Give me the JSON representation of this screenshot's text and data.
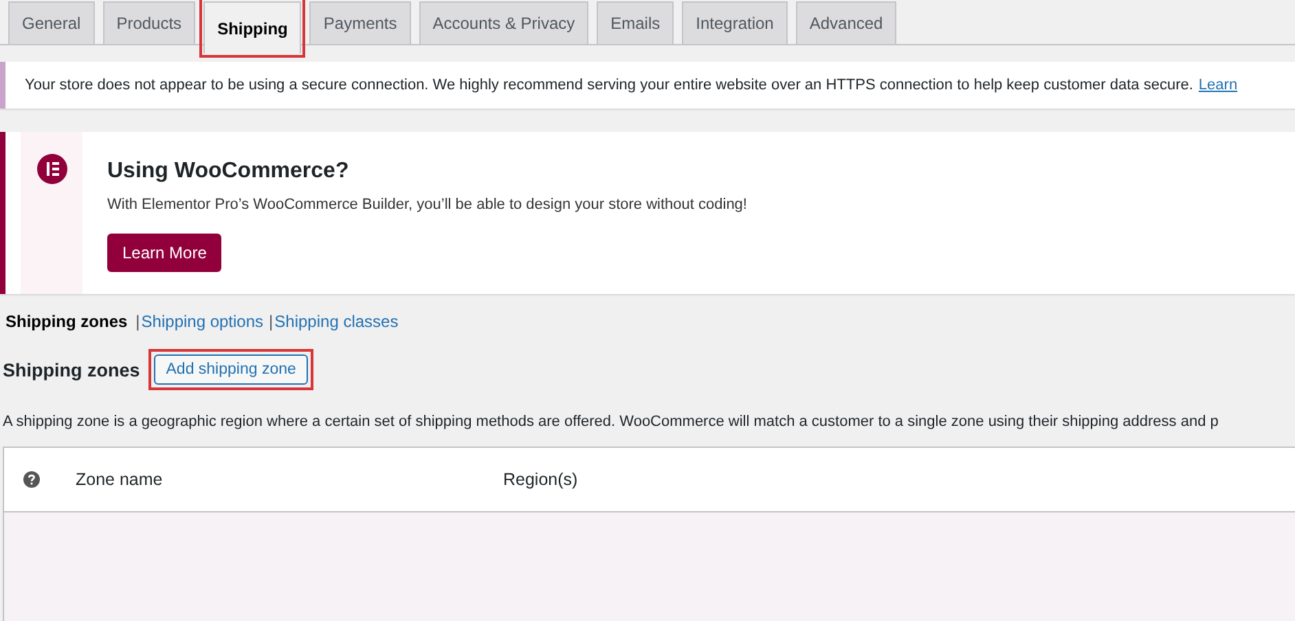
{
  "tabs": [
    {
      "label": "General",
      "selected": false,
      "highlighted": false
    },
    {
      "label": "Products",
      "selected": false,
      "highlighted": false
    },
    {
      "label": "Shipping",
      "selected": true,
      "highlighted": true
    },
    {
      "label": "Payments",
      "selected": false,
      "highlighted": false
    },
    {
      "label": "Accounts & Privacy",
      "selected": false,
      "highlighted": false
    },
    {
      "label": "Emails",
      "selected": false,
      "highlighted": false
    },
    {
      "label": "Integration",
      "selected": false,
      "highlighted": false
    },
    {
      "label": "Advanced",
      "selected": false,
      "highlighted": false
    }
  ],
  "notice": {
    "text": "Your store does not appear to be using a secure connection. We highly recommend serving your entire website over an HTTPS connection to help keep customer data secure.",
    "link": "Learn"
  },
  "promo": {
    "title": "Using WooCommerce?",
    "text": "With Elementor Pro’s WooCommerce Builder, you’ll be able to design your store without coding!",
    "button": "Learn More"
  },
  "subnav": [
    {
      "label": "Shipping zones",
      "selected": true
    },
    {
      "label": "Shipping options",
      "selected": false,
      "separator": "|"
    },
    {
      "label": "Shipping classes",
      "selected": false,
      "separator": "|"
    }
  ],
  "section": {
    "title": "Shipping zones",
    "button": {
      "label": "Add shipping zone",
      "highlighted": true
    },
    "description": "A shipping zone is a geographic region where a certain set of shipping methods are offered. WooCommerce will match a customer to a single zone using their shipping address and p"
  },
  "table": {
    "columns": [
      "Zone name",
      "Region(s)"
    ]
  }
}
